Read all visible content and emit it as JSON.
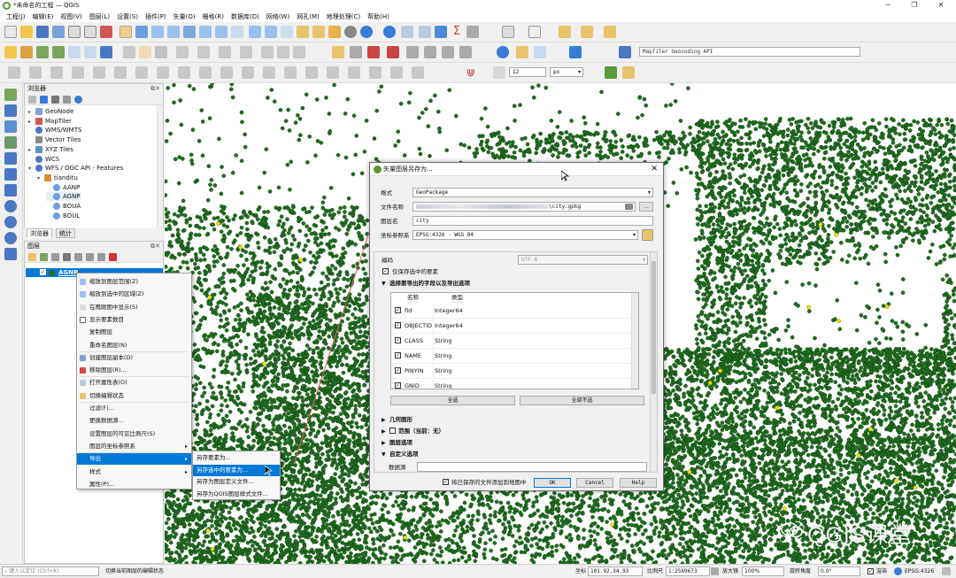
{
  "window": {
    "title": "*未命名的工程 — QGIS",
    "controls": [
      "─",
      "❐",
      "✕"
    ]
  },
  "menubar": [
    "工程(J)",
    "编辑(E)",
    "视图(V)",
    "图层(L)",
    "设置(S)",
    "插件(P)",
    "矢量(O)",
    "栅格(R)",
    "数据库(D)",
    "网络(W)",
    "网孔(M)",
    "地理处理(C)",
    "帮助(H)"
  ],
  "toolbar": {
    "geocoder_placeholder": "MapTiler Geocoding API",
    "font_size_value": "12",
    "font_unit": "px"
  },
  "browser_panel": {
    "title": "浏览器",
    "items": [
      {
        "label": "GeoNode",
        "icon": "geonode-icon",
        "indent": 0,
        "expander": "▸"
      },
      {
        "label": "MapTiler",
        "icon": "maptiler-icon",
        "indent": 0,
        "expander": "▸"
      },
      {
        "label": "WMS/WMTS",
        "icon": "wms-icon",
        "indent": 0,
        "expander": ""
      },
      {
        "label": "Vector Tiles",
        "icon": "vector-tiles-icon",
        "indent": 0,
        "expander": ""
      },
      {
        "label": "XYZ Tiles",
        "icon": "xyz-tiles-icon",
        "indent": 0,
        "expander": "▸"
      },
      {
        "label": "WCS",
        "icon": "wcs-icon",
        "indent": 0,
        "expander": ""
      },
      {
        "label": "WFS / OGC API - Features",
        "icon": "wfs-icon",
        "indent": 0,
        "expander": "▾"
      },
      {
        "label": "tianditu",
        "icon": "connection-icon",
        "indent": 1,
        "expander": "▾"
      },
      {
        "label": "AANP",
        "icon": "wfs-layer-icon",
        "indent": 2,
        "expander": ""
      },
      {
        "label": "AGNP",
        "icon": "wfs-layer-icon",
        "indent": 2,
        "expander": ""
      },
      {
        "label": "BOUA",
        "icon": "wfs-layer-icon",
        "indent": 2,
        "expander": ""
      },
      {
        "label": "BOUL",
        "icon": "wfs-layer-icon",
        "indent": 2,
        "expander": ""
      }
    ],
    "tabs": [
      "浏览器",
      "统计"
    ]
  },
  "layers_panel": {
    "title": "图层",
    "layer": {
      "name": "AGNP",
      "checked": true
    }
  },
  "context_menu": {
    "items": [
      {
        "label": "缩放到图层范围(Z)",
        "icon": "zoom-layer-icon"
      },
      {
        "label": "缩放到选中的区域(Z)",
        "icon": "zoom-selection-icon"
      },
      {
        "label": "在鹰眼图中显示(S)",
        "icon": "overview-icon"
      },
      {
        "label": "显示要素数目",
        "icon": "checkbox-icon"
      },
      {
        "label": "复制图层",
        "icon": ""
      },
      {
        "label": "重命名图层(N)",
        "icon": ""
      },
      {
        "label": "创建图层副本(D)",
        "icon": "duplicate-icon"
      },
      {
        "label": "移除图层(R)...",
        "icon": "remove-layer-icon"
      },
      {
        "label": "打开属性表(O)",
        "icon": "attribute-table-icon"
      },
      {
        "label": "切换编辑状态",
        "icon": "pencil-icon"
      },
      {
        "label": "过滤(F)...",
        "icon": ""
      },
      {
        "label": "更换数据源...",
        "icon": ""
      },
      {
        "label": "设置图层的可见比例尺(S)",
        "icon": ""
      },
      {
        "label": "图层的坐标参照系",
        "icon": "",
        "submenu": true
      },
      {
        "label": "导出",
        "icon": "",
        "submenu": true,
        "highlight": true
      },
      {
        "label": "样式",
        "icon": "",
        "submenu": true
      },
      {
        "label": "属性(P)...",
        "icon": ""
      }
    ],
    "export_submenu": [
      {
        "label": "另存要素为..."
      },
      {
        "label": "另存选中的要素为...",
        "highlight": true
      },
      {
        "label": "另存为图层定义文件..."
      },
      {
        "label": "另存为QGIS图层样式文件..."
      }
    ]
  },
  "dialog": {
    "title": "矢量图层另存为...",
    "format_label": "格式",
    "format_value": "GeoPackage",
    "filename_label": "文件名称",
    "filename_value": "\\city.gpkg",
    "layername_label": "图层名",
    "layername_value": "city",
    "crs_label": "坐标参照系",
    "crs_value": "EPSG:4326 - WGS 84",
    "encoding_label": "编码",
    "encoding_value": "UTF-8",
    "save_selected_label": "仅保存选中的要素",
    "fields_section": "选择要导出的字段以及导出选项",
    "fields_header": [
      "名称",
      "类型"
    ],
    "fields": [
      {
        "name": "fid",
        "type": "Integer64"
      },
      {
        "name": "OBJECTID",
        "type": "Integer64"
      },
      {
        "name": "CLASS",
        "type": "String"
      },
      {
        "name": "NAME",
        "type": "String"
      },
      {
        "name": "PINYIN",
        "type": "String"
      },
      {
        "name": "GNID",
        "type": "String"
      }
    ],
    "select_all": "全选",
    "deselect_all": "全部不选",
    "geometry_section": "几何图形",
    "extent_section": "范围（当前：无）",
    "layer_options_section": "图层选项",
    "custom_options_section": "自定义选项",
    "datasource_label": "数据源",
    "add_to_map_label": "将已保存的文件添加到地图中",
    "ok": "OK",
    "cancel": "Cancel",
    "help": "Help",
    "browse_button": "..."
  },
  "statusbar": {
    "locator_placeholder": "键入以定位 (Ctrl+K)",
    "message": "切换当前图层的编辑状态",
    "coordinate_label": "坐标",
    "coordinate_value": "101.92,34.93",
    "scale_label": "比例尺",
    "scale_value": "1:2569673",
    "magnifier_label": "放大镜",
    "magnifier_value": "100%",
    "rotation_label": "旋转角度",
    "rotation_value": "0.0°",
    "render_label": "渲染",
    "crs": "EPSG:4326"
  },
  "watermark": "QGIS课堂",
  "colors": {
    "point_fill": "#1e6e1e",
    "highlight_point": "#f4e000",
    "selection": "#0078d7",
    "arrow": "#e06060"
  }
}
